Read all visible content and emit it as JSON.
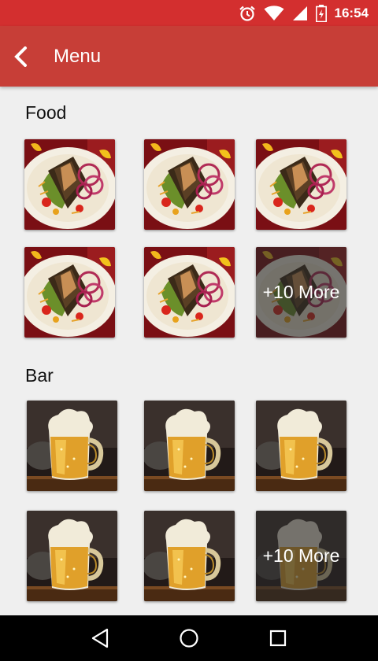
{
  "status_bar": {
    "time": "16:54",
    "icons": [
      "alarm-icon",
      "wifi-icon",
      "signal-icon",
      "battery-icon"
    ]
  },
  "app_bar": {
    "title": "Menu",
    "back_icon": "chevron-left-icon"
  },
  "sections": [
    {
      "title": "Food",
      "more_label": "+10 More",
      "image": "salad-plate"
    },
    {
      "title": "Bar",
      "more_label": "+10 More",
      "image": "beer-mug"
    }
  ],
  "nav_bar": {
    "icons": [
      "back-triangle-icon",
      "home-circle-icon",
      "recents-square-icon"
    ]
  },
  "colors": {
    "status_bar": "#d32f2f",
    "app_bar": "#c73e37",
    "background": "#efefef"
  }
}
